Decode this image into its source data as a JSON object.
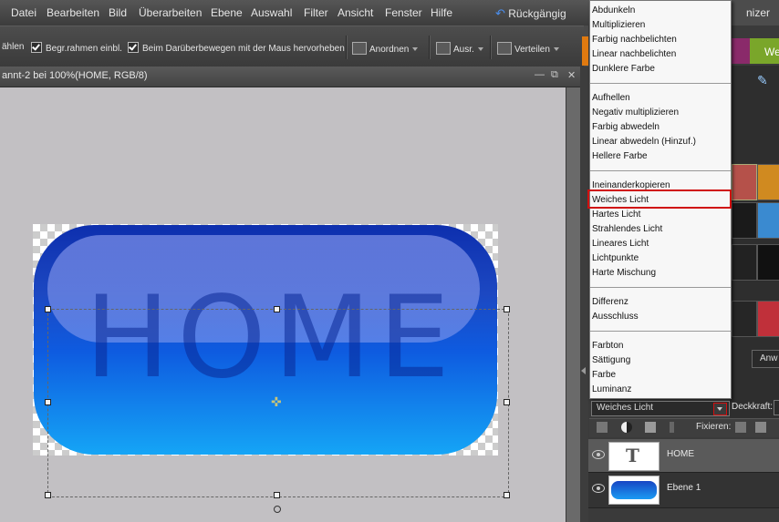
{
  "menubar": {
    "items": [
      "Datei",
      "Bearbeiten",
      "Bild",
      "Überarbeiten",
      "Ebene",
      "Auswahl",
      "Filter",
      "Ansicht",
      "Fenster",
      "Hilfe"
    ],
    "undo_label": "Rückgängig",
    "right_partial": "nizer"
  },
  "optionsbar": {
    "left_partial": "ählen",
    "check1_label": "Begr.rahmen einbl.",
    "check2_label": "Beim Darüberbewegen mit der Maus hervorheben",
    "arrange_label": "Anordnen",
    "align_label": "Ausr.",
    "distribute_label": "Verteilen"
  },
  "document": {
    "title": "annt-2 bei 100%(HOME, RGB/8)",
    "button_text": "HOME"
  },
  "right_panel": {
    "tab_partial": "We",
    "anw_partial": "Anw"
  },
  "blend_menu": {
    "groups": [
      [
        "Abdunkeln",
        "Multiplizieren",
        "Farbig nachbelichten",
        "Linear nachbelichten",
        "Dunklere Farbe"
      ],
      [
        "Aufhellen",
        "Negativ multiplizieren",
        "Farbig abwedeln",
        "Linear abwedeln (Hinzuf.)",
        "Hellere Farbe"
      ],
      [
        "Ineinanderkopieren",
        "Weiches Licht",
        "Hartes Licht",
        "Strahlendes Licht",
        "Lineares Licht",
        "Lichtpunkte",
        "Harte Mischung"
      ],
      [
        "Differenz",
        "Ausschluss"
      ],
      [
        "Farbton",
        "Sättigung",
        "Farbe",
        "Luminanz"
      ]
    ],
    "selected": "Weiches Licht"
  },
  "layers": {
    "blend_mode_value": "Weiches Licht",
    "opacity_label": "Deckkraft:",
    "lock_label": "Fixieren:",
    "rows": [
      {
        "name": "HOME",
        "type": "text"
      },
      {
        "name": "Ebene 1",
        "type": "image"
      }
    ]
  }
}
